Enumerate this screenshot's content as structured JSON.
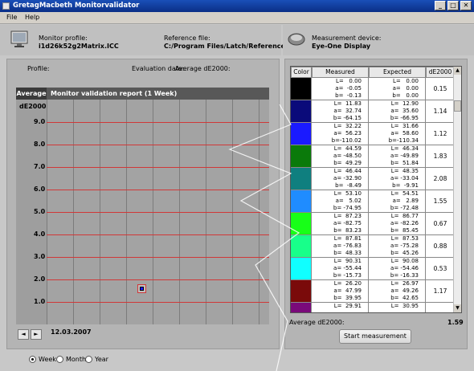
{
  "window": {
    "title": "GretagMacbeth Monitorvalidator"
  },
  "menu": [
    "File",
    "Help"
  ],
  "header": {
    "monitor_profile_label": "Monitor profile:",
    "monitor_profile_value": "i1d26k52g2Matrix.ICC",
    "reference_file_label": "Reference file:",
    "reference_file_value": "C:/Program Files/Latch/Reference.txt",
    "measurement_device_label": "Measurement device:",
    "measurement_device_value": "Eye-One Display"
  },
  "left_panel": {
    "profile_label": "Profile:",
    "evaluation_date_label": "Evaluation date:",
    "average_de_label": "Average dE2000:"
  },
  "chart_data": {
    "type": "scatter",
    "header_tab": "Average",
    "title": "Monitor validation report (1 Week)",
    "ylabel": "dE2000",
    "ylim": [
      0,
      10
    ],
    "yticks": [
      "9.0",
      "8.0",
      "7.0",
      "6.0",
      "5.0",
      "4.0",
      "3.0",
      "2.0",
      "1.0"
    ],
    "points": [
      {
        "x": "12.03.2007",
        "y": 1.59
      }
    ]
  },
  "date_nav": {
    "prev": "◄",
    "next": "►",
    "date": "12.03.2007"
  },
  "period_options": [
    {
      "label": "Week",
      "selected": true
    },
    {
      "label": "Month",
      "selected": false
    },
    {
      "label": "Year",
      "selected": false
    }
  ],
  "table": {
    "headers": [
      "Color",
      "Measured",
      "Expected",
      "dE2000"
    ],
    "rows": [
      {
        "color": "#000000",
        "measured": "L=   0.00\na=  -0.05\nb=  -0.13",
        "expected": "L=   0.00\na=   0.00\nb=   0.00",
        "de": "0.15"
      },
      {
        "color": "#0a0a7a",
        "measured": "L=  11.83\na=  32.74\nb= -64.15",
        "expected": "L=  12.90\na=  35.60\nb= -66.95",
        "de": "1.14"
      },
      {
        "color": "#1a1aff",
        "measured": "L=  32.22\na=  56.23\nb=-110.02",
        "expected": "L=  31.66\na=  58.60\nb=-110.34",
        "de": "1.12"
      },
      {
        "color": "#0a7a0a",
        "measured": "L=  44.59\na= -48.50\nb=  49.29",
        "expected": "L=  46.34\na= -49.89\nb=  51.84",
        "de": "1.83"
      },
      {
        "color": "#0f7f7f",
        "measured": "L=  46.44\na= -32.90\nb=  -8.49",
        "expected": "L=  48.35\na= -33.04\nb=  -9.91",
        "de": "2.08"
      },
      {
        "color": "#1f8cff",
        "measured": "L=  53.10\na=   5.02\nb= -74.95",
        "expected": "L=  54.51\na=   2.89\nb= -72.48",
        "de": "1.55"
      },
      {
        "color": "#18ff18",
        "measured": "L=  87.23\na= -82.75\nb=  83.23",
        "expected": "L=  86.77\na= -82.26\nb=  85.45",
        "de": "0.67"
      },
      {
        "color": "#18ff8a",
        "measured": "L=  87.81\na= -76.83\nb=  48.33",
        "expected": "L=  87.53\na= -75.28\nb=  45.26",
        "de": "0.88"
      },
      {
        "color": "#10ffff",
        "measured": "L=  90.31\na= -55.44\nb= -15.73",
        "expected": "L=  90.08\na= -54.46\nb= -16.33",
        "de": "0.53"
      },
      {
        "color": "#7a0a0a",
        "measured": "L=  26.20\na=  47.99\nb=  39.95",
        "expected": "L=  26.97\na=  49.26\nb=  42.65",
        "de": "1.17"
      },
      {
        "color": "#7a0a7a",
        "measured": "L=  29.91",
        "expected": "L=  30.95",
        "de": ""
      }
    ]
  },
  "summary": {
    "average_label": "Average dE2000:",
    "average_value": "1.59"
  },
  "actions": {
    "start_label": "Start measurement"
  },
  "colors": {
    "titlebar": "#0b2f86",
    "gridline": "#d03838",
    "marker": "#1a1aff",
    "marker_border": "#d03838"
  }
}
